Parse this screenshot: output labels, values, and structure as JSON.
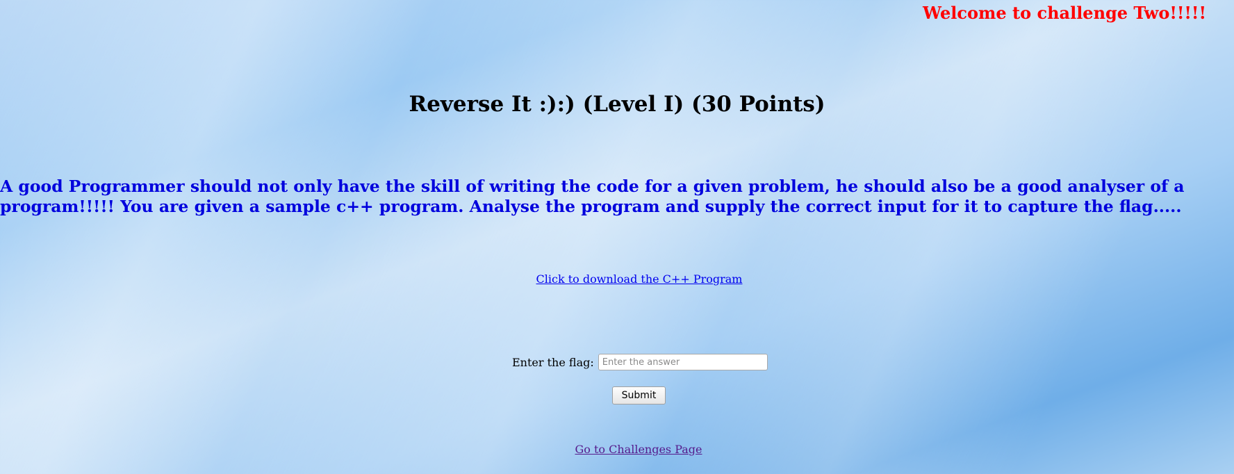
{
  "header": {
    "welcome": "Welcome to challenge Two!!!!!"
  },
  "challenge": {
    "title": "Reverse It :):) (Level I) (30 Points)",
    "description": "A good Programmer should not only have the skill of writing the code for a given problem, he should also be a good analyser of a program!!!!! You are given a sample c++ program. Analyse the program and supply the correct input for it to capture the flag.....",
    "download_link": "Click to download the C++ Program"
  },
  "form": {
    "flag_label": "Enter the flag:",
    "flag_value": "",
    "flag_placeholder": "Enter the answer",
    "submit_label": "Submit"
  },
  "footer": {
    "challenges_link": "Go to Challenges Page"
  },
  "colors": {
    "welcome": "#ff0000",
    "description": "#0000dd",
    "link": "#0000ee",
    "visited_link": "#551a8b"
  }
}
